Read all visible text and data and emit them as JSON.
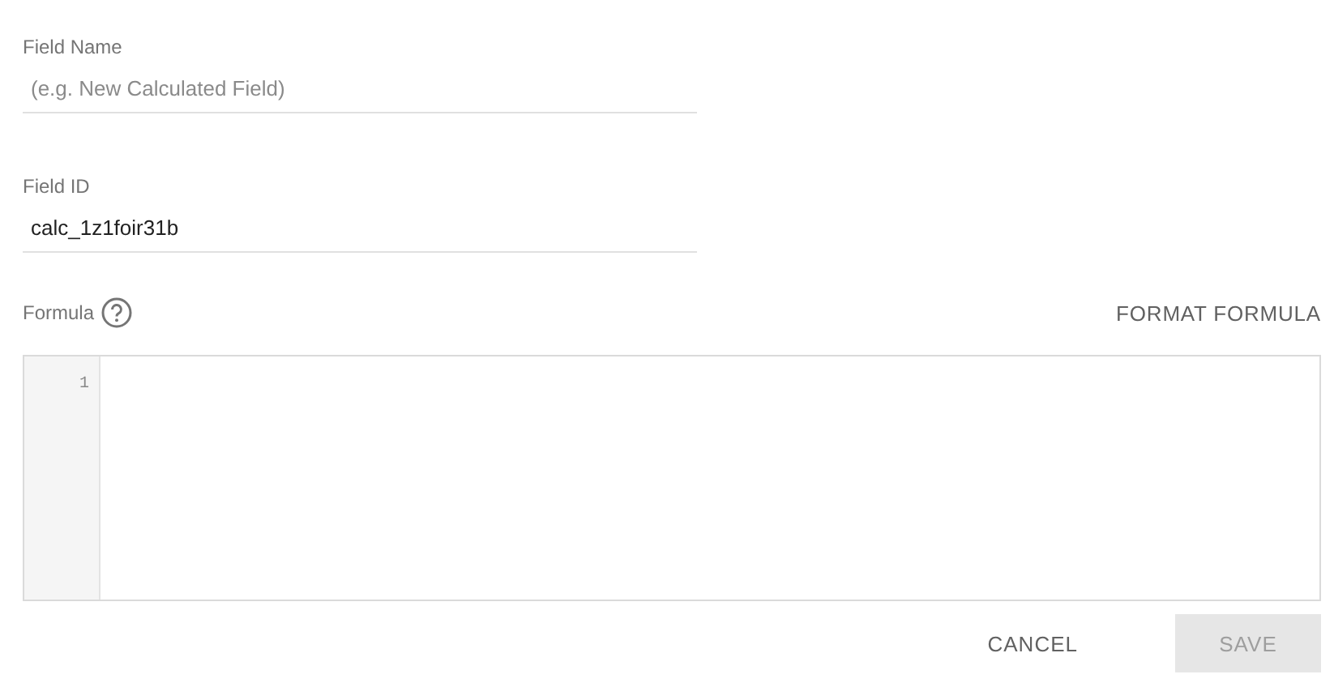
{
  "fields": [
    {
      "label": "Field Name",
      "placeholder": "(e.g. New Calculated Field)"
    },
    {
      "label": "Field ID",
      "value": "calc_1z1foir31b"
    }
  ],
  "formula": {
    "label": "Formula",
    "format_button": "FORMAT FORMULA",
    "line_numbers": [
      "1"
    ]
  },
  "buttons": [
    {
      "label": "CANCEL",
      "kind": "text",
      "disabled": false
    },
    {
      "label": "SAVE",
      "kind": "filled",
      "disabled": true
    }
  ]
}
